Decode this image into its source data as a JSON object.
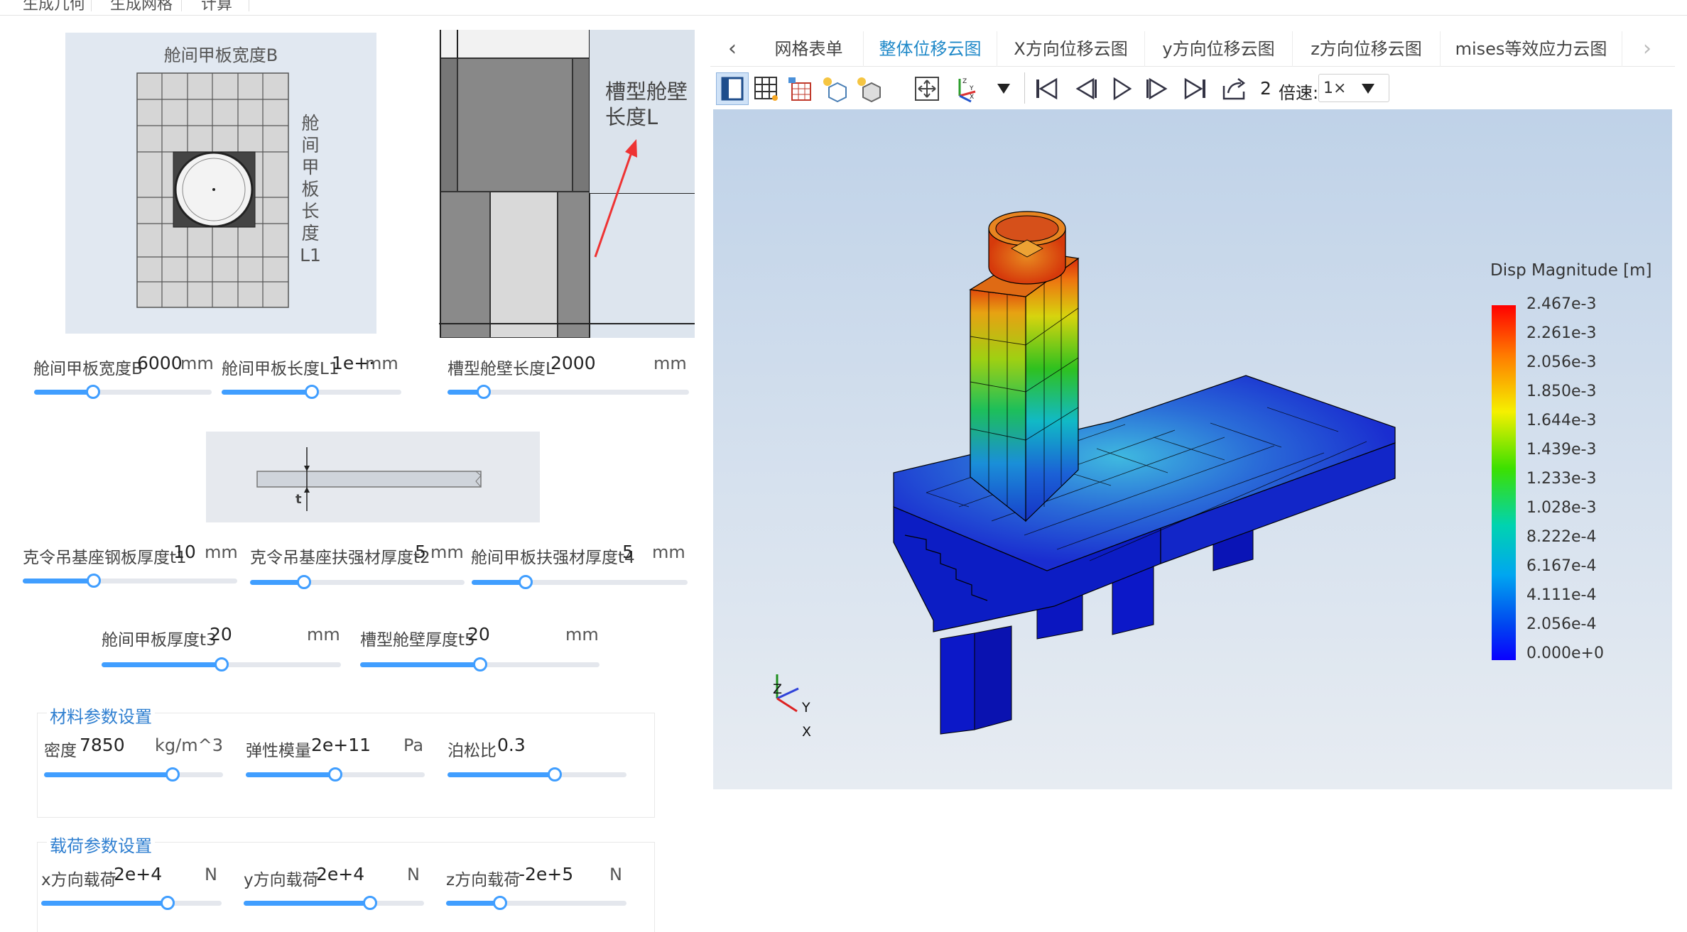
{
  "top_menu": [
    "生成几何",
    "生成网格",
    "计算"
  ],
  "diagram1": {
    "title": "舱间甲板宽度B",
    "side_label_chars": [
      "舱",
      "间",
      "甲",
      "板",
      "长",
      "度",
      "L1"
    ]
  },
  "diagram2": {
    "label_line1": "槽型舱壁",
    "label_line2": "长度L"
  },
  "diagram3": {
    "label": "t"
  },
  "params": {
    "deck_width": {
      "label": "舱间甲板宽度B",
      "value": "6000",
      "unit": "mm",
      "fraction": 0.33
    },
    "deck_length": {
      "label": "舱间甲板长度L1",
      "value": "1e+·",
      "unit": "mm",
      "fraction": 0.5
    },
    "bulkhead_length": {
      "label": "槽型舱壁长度L",
      "value": "2000",
      "unit": "mm",
      "fraction": 0.15
    },
    "t1": {
      "label": "克令吊基座钢板厚度t1",
      "value": "10",
      "unit": "mm",
      "fraction": 0.33
    },
    "t2": {
      "label": "克令吊基座扶强材厚度t2",
      "value": "5",
      "unit": "mm",
      "fraction": 0.25
    },
    "t4": {
      "label": "舱间甲板扶强材厚度t4",
      "value": "5",
      "unit": "mm",
      "fraction": 0.25
    },
    "t3": {
      "label": "舱间甲板厚度t3",
      "value": "20",
      "unit": "mm",
      "fraction": 0.5
    },
    "t5": {
      "label": "槽型舱壁厚度t5",
      "value": "20",
      "unit": "mm",
      "fraction": 0.5
    }
  },
  "material": {
    "title": "材料参数设置",
    "density": {
      "label": "密度",
      "value": "7850",
      "unit": "kg/m^3",
      "fraction": 0.72
    },
    "modulus": {
      "label": "弹性模量",
      "value": "2e+11",
      "unit": "Pa",
      "fraction": 0.5
    },
    "poisson": {
      "label": "泊松比",
      "value": "0.3",
      "fraction": 0.6
    }
  },
  "load": {
    "title": "载荷参数设置",
    "fx": {
      "label": "x方向载荷",
      "value": "2e+4",
      "unit": "N",
      "fraction": 0.7
    },
    "fy": {
      "label": "y方向载荷",
      "value": "2e+4",
      "unit": "N",
      "fraction": 0.7
    },
    "fz": {
      "label": "z方向载荷",
      "value": "-2e+5",
      "unit": "N",
      "fraction": 0.3
    }
  },
  "tabs": {
    "prev": "‹",
    "next": "›",
    "items": [
      "网格表单",
      "整体位移云图",
      "X方向位移云图",
      "y方向位移云图",
      "z方向位移云图",
      "mises等效应力云图"
    ],
    "active_index": 1
  },
  "toolbar": {
    "icons": [
      "view-panel-icon",
      "mesh-grid-icon",
      "table-icon",
      "light-cube-icon",
      "light-cube2-icon",
      "fit-view-icon",
      "axes-icon",
      "first-frame-icon",
      "prev-frame-icon",
      "play-icon",
      "next-frame-icon",
      "last-frame-icon",
      "export-icon"
    ],
    "frame": "2",
    "speed_label": "倍速:",
    "speed_value": "1×"
  },
  "legend": {
    "title": "Disp Magnitude [m]",
    "ticks": [
      "2.467e-3",
      "2.261e-3",
      "2.056e-3",
      "1.850e-3",
      "1.644e-3",
      "1.439e-3",
      "1.233e-3",
      "1.028e-3",
      "8.222e-4",
      "6.167e-4",
      "4.111e-4",
      "2.056e-4",
      "0.000e+0"
    ]
  },
  "triad": {
    "z": "Z",
    "y": "Y",
    "x": "X"
  }
}
